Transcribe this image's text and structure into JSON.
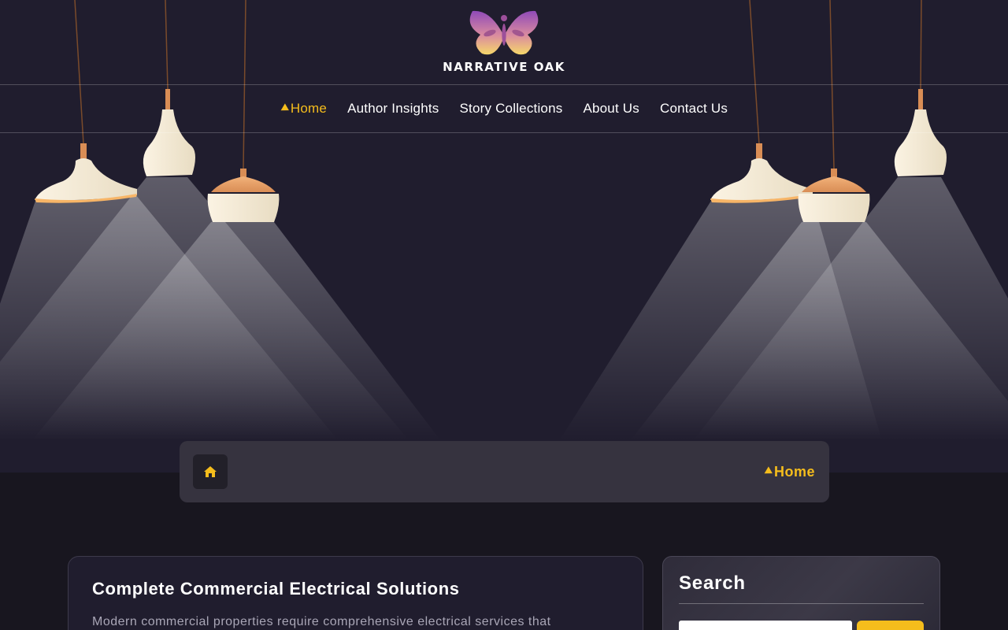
{
  "brand": {
    "name": "NARRATIVE OAK"
  },
  "nav": {
    "items": [
      {
        "label": "Home",
        "active": true
      },
      {
        "label": "Author Insights",
        "active": false
      },
      {
        "label": "Story Collections",
        "active": false
      },
      {
        "label": "About Us",
        "active": false
      },
      {
        "label": "Contact Us",
        "active": false
      }
    ]
  },
  "breadcrumb": {
    "current": "Home"
  },
  "article": {
    "title": "Complete Commercial Electrical Solutions",
    "excerpt": "Modern commercial properties require comprehensive electrical services that"
  },
  "sidebar": {
    "search_title": "Search",
    "search_placeholder": "",
    "search_button_label": ""
  },
  "colors": {
    "accent": "#f5bd1c",
    "hero_bg": "#201d2e",
    "page_bg": "#18161f",
    "panel": "#36333f"
  },
  "icons": {
    "nav_active": "arrow-icon",
    "breadcrumb_home": "home-icon"
  }
}
